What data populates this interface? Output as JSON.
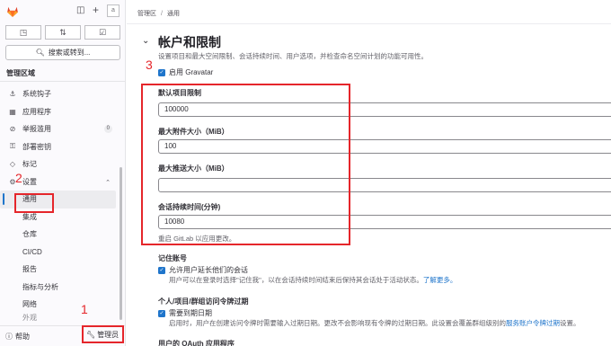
{
  "sidebar": {
    "avatar_alt": "a",
    "search_label": "搜索或转到...",
    "section_title": "管理区域",
    "items": [
      {
        "label": "系统钩子",
        "icon": "hook-icon",
        "glyph": "⚓"
      },
      {
        "label": "应用程序",
        "icon": "apps-icon",
        "glyph": "▦"
      },
      {
        "label": "举报滥用",
        "icon": "abuse-icon",
        "glyph": "⊘",
        "badge": "0"
      },
      {
        "label": "部署密钥",
        "icon": "key-icon",
        "glyph": "⚿"
      },
      {
        "label": "标记",
        "icon": "label-icon",
        "glyph": "◇"
      },
      {
        "label": "设置",
        "icon": "settings-icon",
        "glyph": "⚙"
      }
    ],
    "subitems": [
      "通用",
      "集成",
      "仓库",
      "CI/CD",
      "报告",
      "指标与分析",
      "网络",
      "外观"
    ],
    "help_label": "帮助",
    "admin_label": "管理员"
  },
  "breadcrumb": {
    "root": "管理区",
    "current": "通用"
  },
  "section": {
    "title": "帐户和限制",
    "description": "设置项目和最大空间限制、会话持续时间、用户选项，并检查命名空间计划的功能可用性。"
  },
  "gravatar_label": "启用 Gravatar",
  "fields": [
    {
      "label": "默认项目限制",
      "value": "100000"
    },
    {
      "label": "最大附件大小（MiB）",
      "value": "100"
    },
    {
      "label": "最大推送大小（MiB）",
      "value": ""
    },
    {
      "label": "会话持续时间(分钟)",
      "value": "10080"
    }
  ],
  "restart_hint": "重启 GitLab 以应用更改。",
  "remember_me": {
    "heading": "记住账号",
    "checkbox_label": "允许用户延长他们的会话",
    "help_text": "用户可以在登录时选择\"记住我\"，以在会话持续时间结束后保持其会话处于活动状态。",
    "link": "了解更多。"
  },
  "token_expiry": {
    "heading": "个人/项目/群组访问令牌过期",
    "checkbox_label": "需要到期日期",
    "help_text": "启用时，用户在创建访问令牌时需要输入过期日期。更改不会影响现有令牌的过期日期。此设置会覆盖群组级别的",
    "link": "服务账户令牌过期",
    "help_tail": "设置。"
  },
  "oauth_heading": "用户的 OAuth 应用程序",
  "annotations": [
    "1",
    "2",
    "3"
  ],
  "colors": {
    "annotation": "#e5262b",
    "accent": "#1f75cb"
  }
}
